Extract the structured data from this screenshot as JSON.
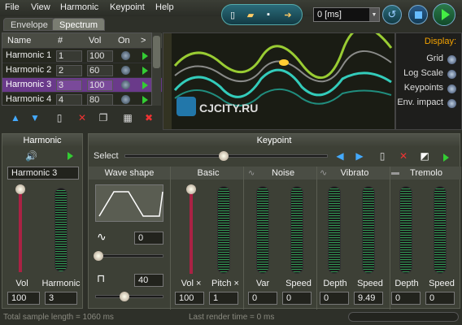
{
  "menu": [
    "File",
    "View",
    "Harmonic",
    "Keypoint",
    "Help"
  ],
  "tabs": [
    "Envelope",
    "Spectrum"
  ],
  "toolbar": {
    "ms_value": "0 [ms]"
  },
  "table": {
    "headers": [
      "Name",
      "#",
      "Vol",
      "On",
      ">"
    ],
    "rows": [
      {
        "name": "Harmonic 1",
        "num": "1",
        "vol": "100"
      },
      {
        "name": "Harmonic 2",
        "num": "2",
        "vol": "60"
      },
      {
        "name": "Harmonic 3",
        "num": "3",
        "vol": "100"
      },
      {
        "name": "Harmonic 4",
        "num": "4",
        "vol": "80"
      }
    ],
    "selected_index": 2
  },
  "watermark": "CJCITY.RU",
  "display": {
    "title": "Display:",
    "options": [
      "Grid",
      "Log Scale",
      "Keypoints",
      "Env. impact"
    ]
  },
  "harmonic_panel": {
    "title": "Harmonic",
    "name_value": "Harmonic 3",
    "vol_label": "Vol",
    "harmonic_label": "Harmonic",
    "vol_value": "100",
    "harmonic_value": "3"
  },
  "keypoint": {
    "title": "Keypoint",
    "select_label": "Select"
  },
  "sections": {
    "wave_shape": {
      "title": "Wave shape",
      "value1": "0",
      "value2": "40"
    },
    "basic": {
      "title": "Basic",
      "vol_label": "Vol ×",
      "pitch_label": "Pitch ×",
      "vol_value": "100",
      "pitch_value": "1"
    },
    "noise": {
      "title": "Noise",
      "var_label": "Var",
      "speed_label": "Speed",
      "var_value": "0",
      "speed_value": "0"
    },
    "vibrato": {
      "title": "Vibrato",
      "depth_label": "Depth",
      "speed_label": "Speed",
      "depth_value": "0",
      "speed_value": "9.49"
    },
    "tremolo": {
      "title": "Tremolo",
      "depth_label": "Depth",
      "speed_label": "Speed",
      "depth_value": "0",
      "speed_value": "0"
    }
  },
  "status": {
    "left": "Total sample length = 1060 ms",
    "center": "Last render time = 0 ms"
  },
  "colors": {
    "accent": "#6a3a8a",
    "toolbar": "#1e5a68"
  }
}
